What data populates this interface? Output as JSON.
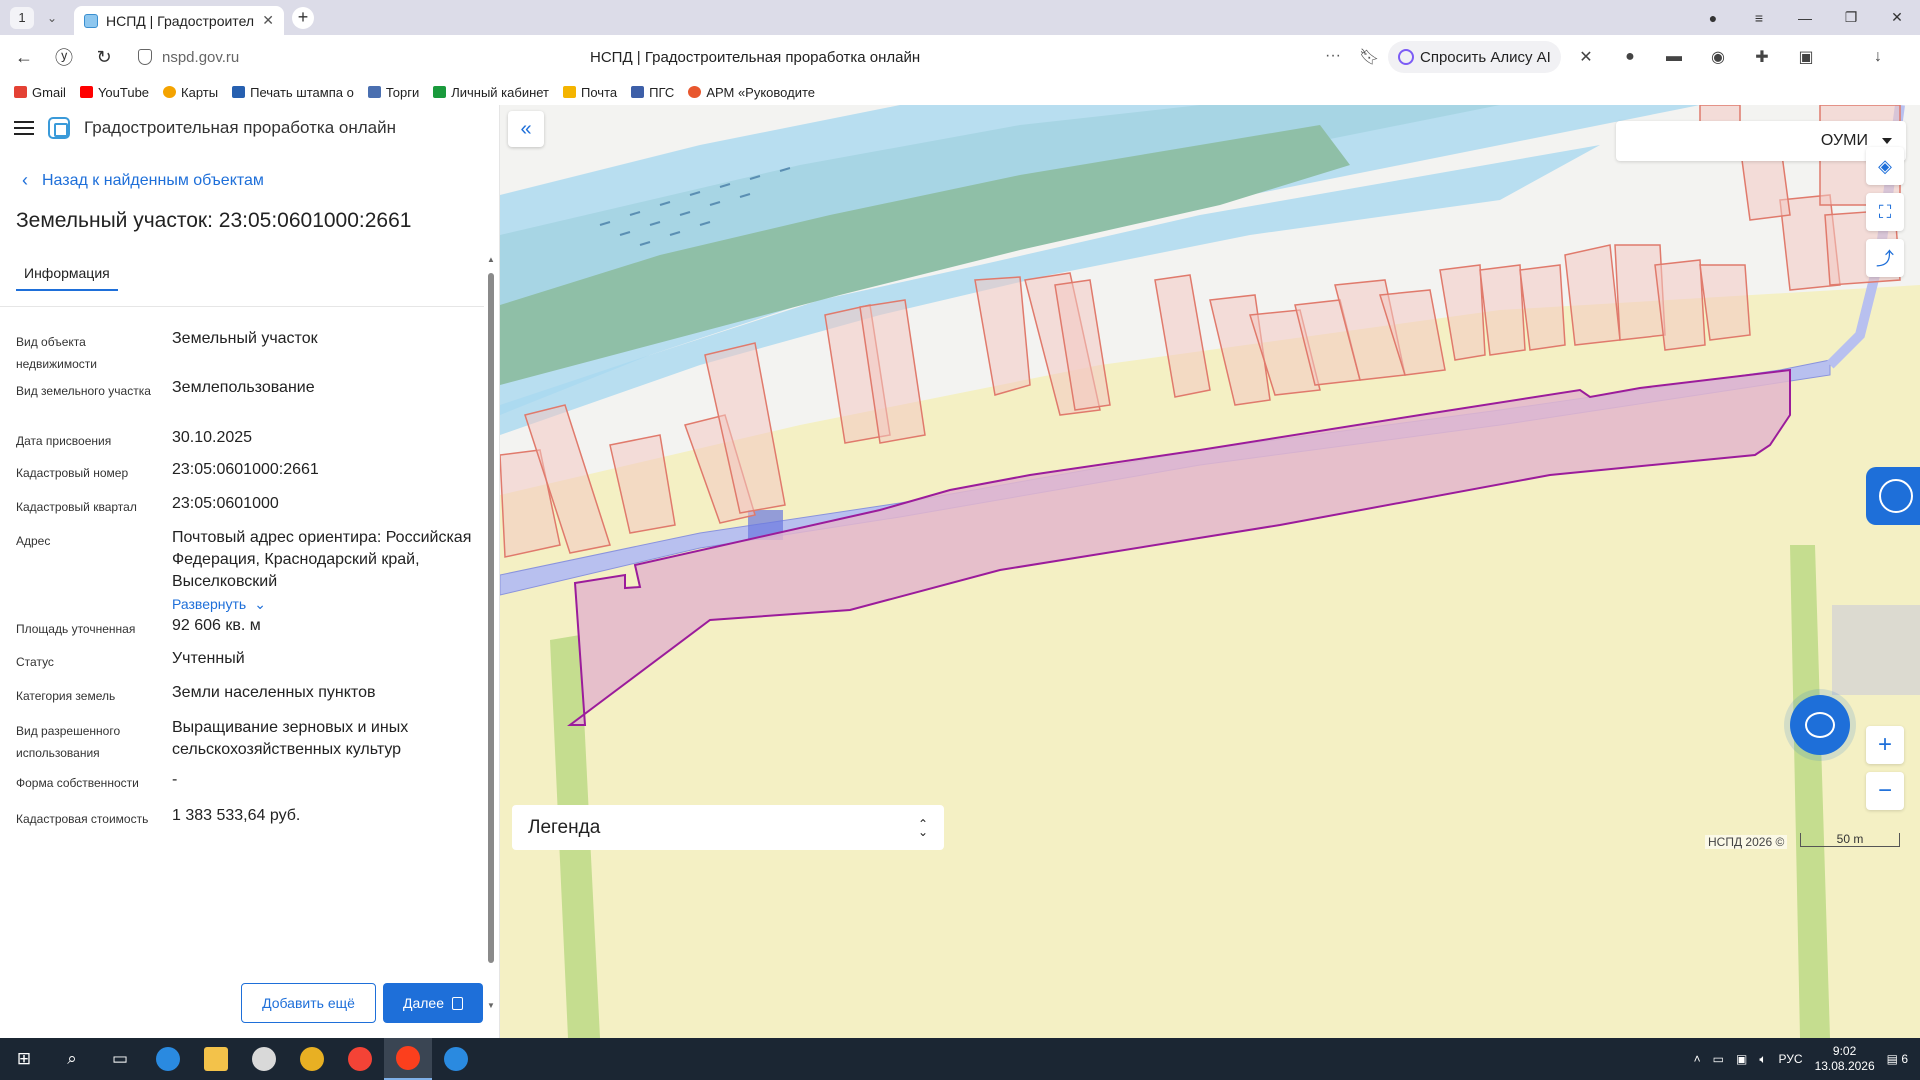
{
  "browser": {
    "tab_count": "1",
    "tab_title": "НСПД | Градостроительная проработка онлайн",
    "url_host": "nspd.gov.ru",
    "page_title": "НСПД | Градостроительная проработка онлайн",
    "alice_label": "Спросить Алису AI",
    "bookmarks": [
      "Gmail",
      "YouTube",
      "Карты",
      "Печать штампа о",
      "Торги",
      "Личный кабинет",
      "Почта",
      "ПГС",
      "АРМ «Руководите"
    ]
  },
  "app": {
    "title": "Градостроительная проработка онлайн",
    "back_label": "Назад к найденным объектам",
    "parcel_title": "Земельный участок: 23:05:0601000:2661",
    "tab_info": "Информация",
    "fields": [
      {
        "label": "Вид объекта недвижимости",
        "value": "Земельный участок"
      },
      {
        "label": "Вид земельного участка",
        "value": "Землепользование"
      },
      {
        "label": "Дата присвоения",
        "value": "30.10.2025"
      },
      {
        "label": "Кадастровый номер",
        "value": "23:05:0601000:2661"
      },
      {
        "label": "Кадастровый квартал",
        "value": "23:05:0601000"
      },
      {
        "label": "Адрес",
        "value": "Почтовый адрес ориентира: Российская Федерация, Краснодарский край, Выселковский"
      },
      {
        "label": "Площадь уточненная",
        "value": "92 606 кв. м"
      },
      {
        "label": "Статус",
        "value": "Учтенный"
      },
      {
        "label": "Категория земель",
        "value": "Земли населенных пунктов"
      },
      {
        "label": "Вид разрешенного использования",
        "value": "Выращивание зерновых и иных сельскохозяйственных культур"
      },
      {
        "label": "Форма собственности",
        "value": "-"
      },
      {
        "label": "Кадастровая стоимость",
        "value": "1 383 533,64 руб."
      }
    ],
    "expand_label": "Развернуть",
    "add_more_label": "Добавить ещё",
    "next_label": "Далее"
  },
  "map": {
    "layer_select": "ОУМИ",
    "legend_label": "Легенда",
    "attribution": "НСПД 2026 ©",
    "scale_label": "50 m",
    "colors": {
      "parcel": "#e3b6cc",
      "parcel_stroke": "#9b1c9b",
      "water": "#a8d8f0",
      "green": "#9ac5b0",
      "field": "#f4f0c4"
    }
  },
  "taskbar": {
    "lang": "РУС",
    "time": "9:02",
    "date": "13.08.2026",
    "notif": "6"
  }
}
